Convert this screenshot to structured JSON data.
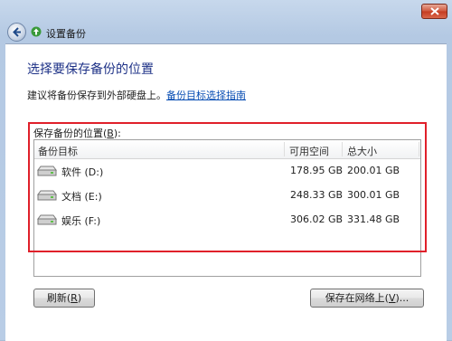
{
  "window": {
    "title": "设置备份"
  },
  "page": {
    "heading": "选择要保存备份的位置",
    "advice_text": "建议将备份保存到外部硬盘上。",
    "advice_link": "备份目标选择指南",
    "location_label_prefix": "保存备份的位置(",
    "location_label_key": "B",
    "location_label_suffix": "):"
  },
  "list": {
    "columns": {
      "target": "备份目标",
      "free": "可用空间",
      "total": "总大小"
    },
    "rows": [
      {
        "name": "软件 (D:)",
        "free": "178.95 GB",
        "total": "200.01 GB"
      },
      {
        "name": "文档 (E:)",
        "free": "248.33 GB",
        "total": "300.01 GB"
      },
      {
        "name": "娱乐 (F:)",
        "free": "306.02 GB",
        "total": "331.48 GB"
      }
    ]
  },
  "buttons": {
    "refresh_prefix": "刷新(",
    "refresh_key": "R",
    "refresh_suffix": ")",
    "network_prefix": "保存在网络上(",
    "network_key": "V",
    "network_suffix": ")..."
  },
  "icons": {
    "back": "back-arrow-icon",
    "app": "backup-icon",
    "close": "close-icon",
    "drive": "hard-drive-icon"
  },
  "colors": {
    "highlight_border": "#e0202a",
    "heading": "#1e3287",
    "link": "#0a4fb4"
  }
}
